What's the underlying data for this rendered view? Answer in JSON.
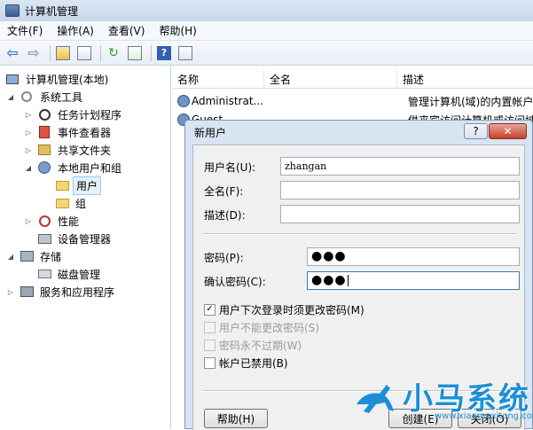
{
  "window": {
    "title": "计算机管理"
  },
  "menu": {
    "items": [
      "文件(F)",
      "操作(A)",
      "查看(V)",
      "帮助(H)"
    ]
  },
  "toolbar": {
    "help_glyph": "?"
  },
  "tree": {
    "items": [
      {
        "label": "计算机管理(本地)",
        "icon": "computer-management-icon"
      },
      {
        "label": "系统工具",
        "icon": "system-tools-icon"
      },
      {
        "label": "任务计划程序",
        "icon": "task-scheduler-icon"
      },
      {
        "label": "事件查看器",
        "icon": "event-viewer-icon"
      },
      {
        "label": "共享文件夹",
        "icon": "shared-folders-icon"
      },
      {
        "label": "本地用户和组",
        "icon": "local-users-groups-icon"
      },
      {
        "label": "用户",
        "icon": "folder-icon"
      },
      {
        "label": "组",
        "icon": "folder-icon"
      },
      {
        "label": "性能",
        "icon": "performance-icon"
      },
      {
        "label": "设备管理器",
        "icon": "device-manager-icon"
      },
      {
        "label": "存储",
        "icon": "storage-icon"
      },
      {
        "label": "磁盘管理",
        "icon": "disk-management-icon"
      },
      {
        "label": "服务和应用程序",
        "icon": "services-apps-icon"
      }
    ]
  },
  "list": {
    "columns": [
      "名称",
      "全名",
      "描述"
    ],
    "rows": [
      {
        "name": "Administrat...",
        "fullname": "",
        "desc": "管理计算机(域)的内置帐户"
      },
      {
        "name": "Guest",
        "fullname": "",
        "desc": "供来宾访问计算机或访问域的"
      }
    ]
  },
  "dialog": {
    "title": "新用户",
    "help_glyph": "?",
    "close_glyph": "✕",
    "username_label": "用户名(U):",
    "username_value": "zhangan",
    "fullname_label": "全名(F):",
    "fullname_value": "",
    "desc_label": "描述(D):",
    "desc_value": "",
    "password_label": "密码(P):",
    "password_value": "●●●",
    "confirm_label": "确认密码(C):",
    "confirm_value": "●●●",
    "options": [
      {
        "label": "用户下次登录时须更改密码(M)",
        "checked": true,
        "enabled": true
      },
      {
        "label": "用户不能更改密码(S)",
        "checked": false,
        "enabled": false
      },
      {
        "label": "密码永不过期(W)",
        "checked": false,
        "enabled": false
      },
      {
        "label": "帐户已禁用(B)",
        "checked": false,
        "enabled": true
      }
    ],
    "help_button": "帮助(H)",
    "create_button": "创建(E)",
    "close_button": "关闭(O)"
  },
  "watermark": {
    "text": "小马系统",
    "url": "www.xiaomaxitong.com"
  },
  "colors": {
    "accent": "#1c8fd8",
    "selection": "#e5f1fb",
    "close": "#c4402c"
  }
}
